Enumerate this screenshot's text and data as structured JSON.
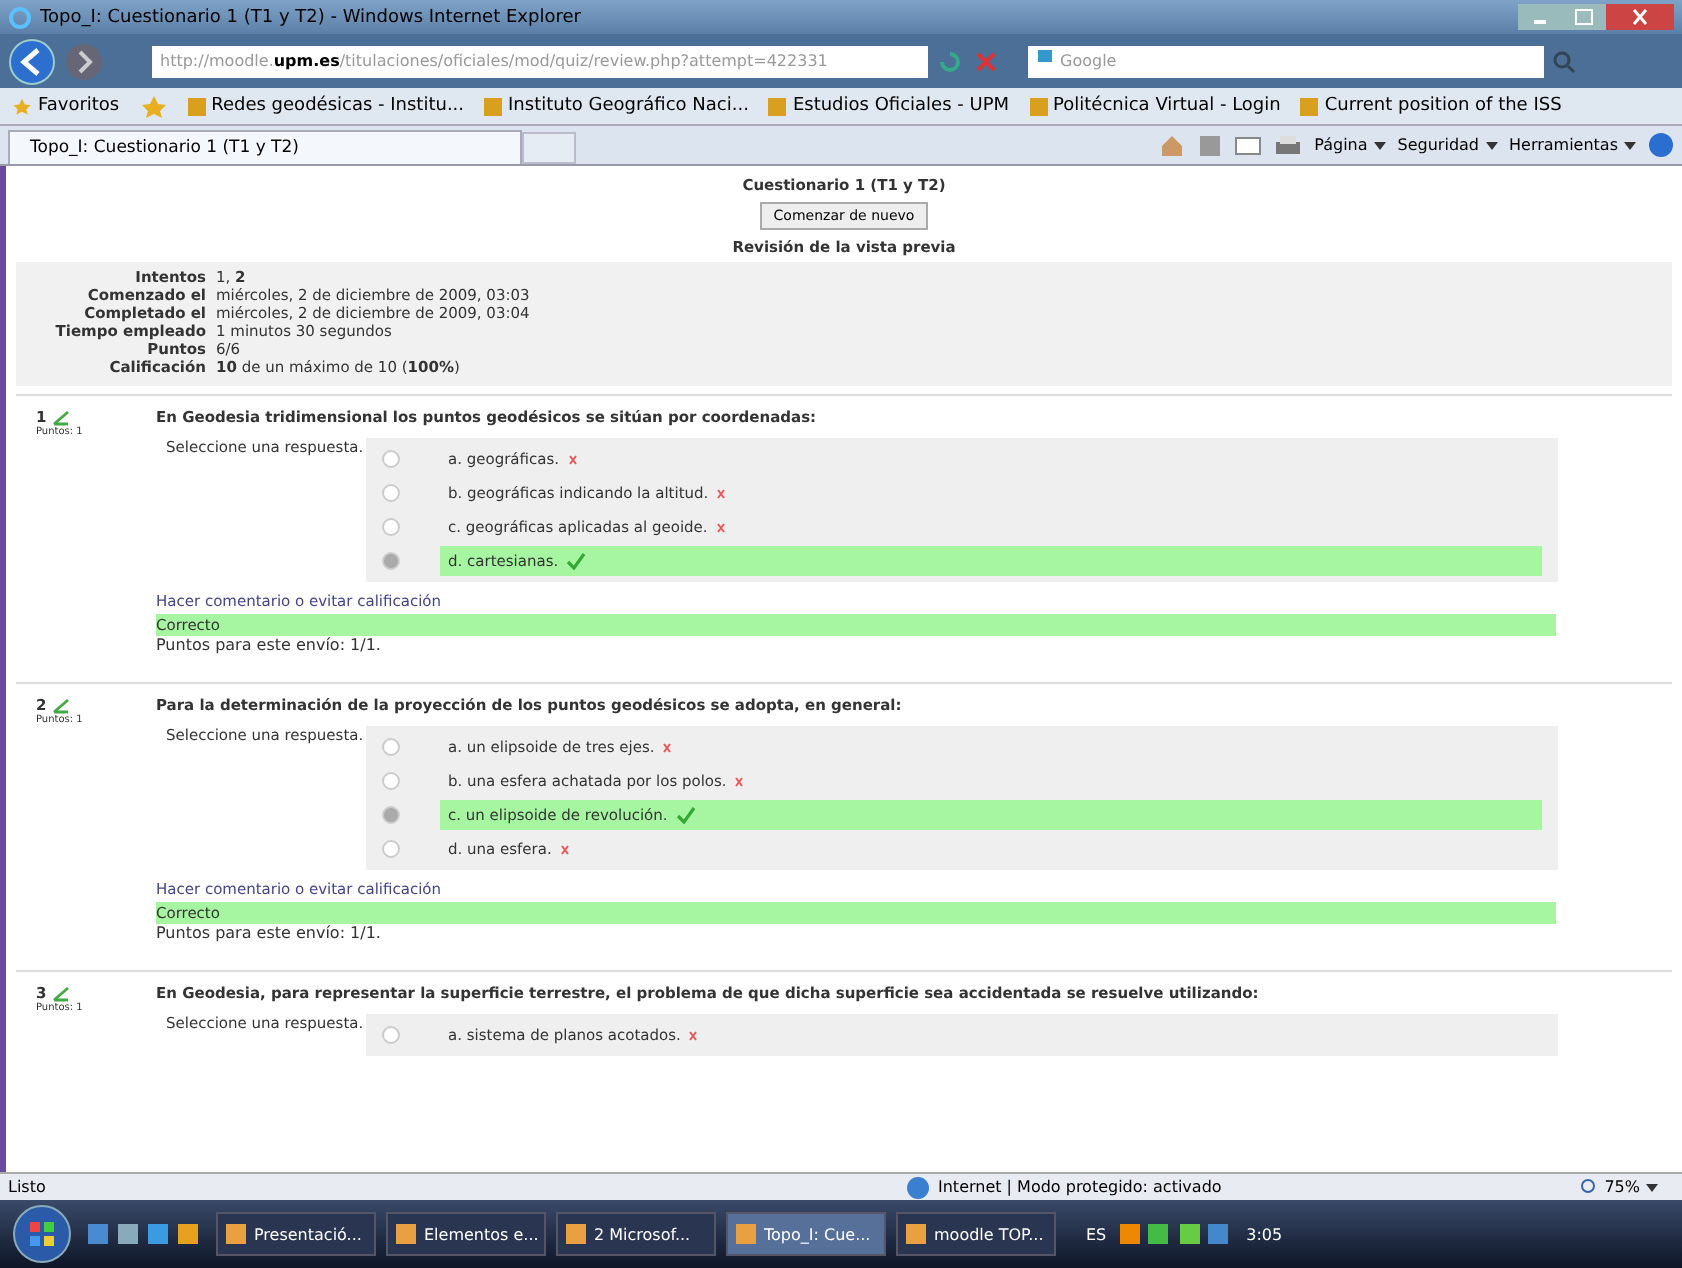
{
  "window": {
    "title": "Topo_I: Cuestionario 1 (T1 y T2) - Windows Internet Explorer"
  },
  "address_bar": {
    "url_prefix": "http://moodle.",
    "url_domain": "upm.es",
    "url_path": "/titulaciones/oficiales/mod/quiz/review.php?attempt=422331",
    "search_placeholder": "Google"
  },
  "favorites": {
    "label": "Favoritos",
    "links": [
      {
        "label": "Redes geodésicas - Institu..."
      },
      {
        "label": "Instituto Geográfico Naci..."
      },
      {
        "label": "Estudios Oficiales - UPM"
      },
      {
        "label": "Politécnica Virtual - Login"
      },
      {
        "label": "Current position of the ISS"
      }
    ]
  },
  "tabs": [
    {
      "label": "Topo_I: Cuestionario 1 (T1 y T2)",
      "selected": true
    }
  ],
  "command_bar": [
    "Página",
    "Seguridad",
    "Herramientas"
  ],
  "page": {
    "quiz_title": "Cuestionario 1 (T1 y T2)",
    "restart_button": "Comenzar de nuevo",
    "preview_heading": "Revisión de la vista previa",
    "summary": [
      {
        "label": "Intentos",
        "value": "1, **2**"
      },
      {
        "label": "Comenzado el",
        "value": "miércoles, 2 de diciembre de 2009, 03:03"
      },
      {
        "label": "Completado el",
        "value": "miércoles, 2 de diciembre de 2009, 03:04"
      },
      {
        "label": "Tiempo empleado",
        "value": "1 minutos 30 segundos"
      },
      {
        "label": "Puntos",
        "value": "6/6"
      },
      {
        "label": "Calificación",
        "value": "**10** de un máximo de 10 (**100%**)"
      }
    ],
    "questions": [
      {
        "number": "1",
        "points": "Puntos: 1",
        "text": "En Geodesia tridimensional los puntos geodésicos se sitúan por coordenadas:",
        "prompt": "Seleccione una respuesta.",
        "options": [
          {
            "label": "a. geográficas.",
            "selected": false,
            "correct": false
          },
          {
            "label": "b. geográficas indicando la altitud.",
            "selected": false,
            "correct": false
          },
          {
            "label": "c. geográficas aplicadas al geoide.",
            "selected": false,
            "correct": false
          },
          {
            "label": "d. cartesianas.",
            "selected": true,
            "correct": true
          }
        ],
        "comment_link": "Hacer comentario o evitar calificación",
        "feedback": "Correcto",
        "score": "Puntos para este envío: 1/1."
      },
      {
        "number": "2",
        "points": "Puntos: 1",
        "text": "Para la determinación de la proyección de los puntos geodésicos se adopta, en general:",
        "prompt": "Seleccione una respuesta.",
        "options": [
          {
            "label": "a. un elipsoide de tres ejes.",
            "selected": false,
            "correct": false
          },
          {
            "label": "b. una esfera achatada por los polos.",
            "selected": false,
            "correct": false
          },
          {
            "label": "c. un elipsoide de revolución.",
            "selected": true,
            "correct": true
          },
          {
            "label": "d. una esfera.",
            "selected": false,
            "correct": false
          }
        ],
        "comment_link": "Hacer comentario o evitar calificación",
        "feedback": "Correcto",
        "score": "Puntos para este envío: 1/1."
      },
      {
        "number": "3",
        "points": "Puntos: 1",
        "text": "En Geodesia, para representar la superficie terrestre, el problema de que dicha superficie sea accidentada se resuelve utilizando:",
        "prompt": "Seleccione una respuesta.",
        "options": [
          {
            "label": "a. sistema de planos acotados.",
            "selected": false,
            "correct": false
          }
        ]
      }
    ]
  },
  "status_bar": {
    "text": "Listo",
    "zone": "Internet | Modo protegido: activado",
    "zoom": "75%"
  },
  "taskbar": {
    "items": [
      {
        "label": "Presentació...",
        "selected": false
      },
      {
        "label": "Elementos e...",
        "selected": false
      },
      {
        "label": "2 Microsof...",
        "selected": false
      },
      {
        "label": "Topo_I: Cue...",
        "selected": true
      },
      {
        "label": "moodle TOP...",
        "selected": false
      }
    ],
    "language": "ES",
    "time": "3:05"
  }
}
